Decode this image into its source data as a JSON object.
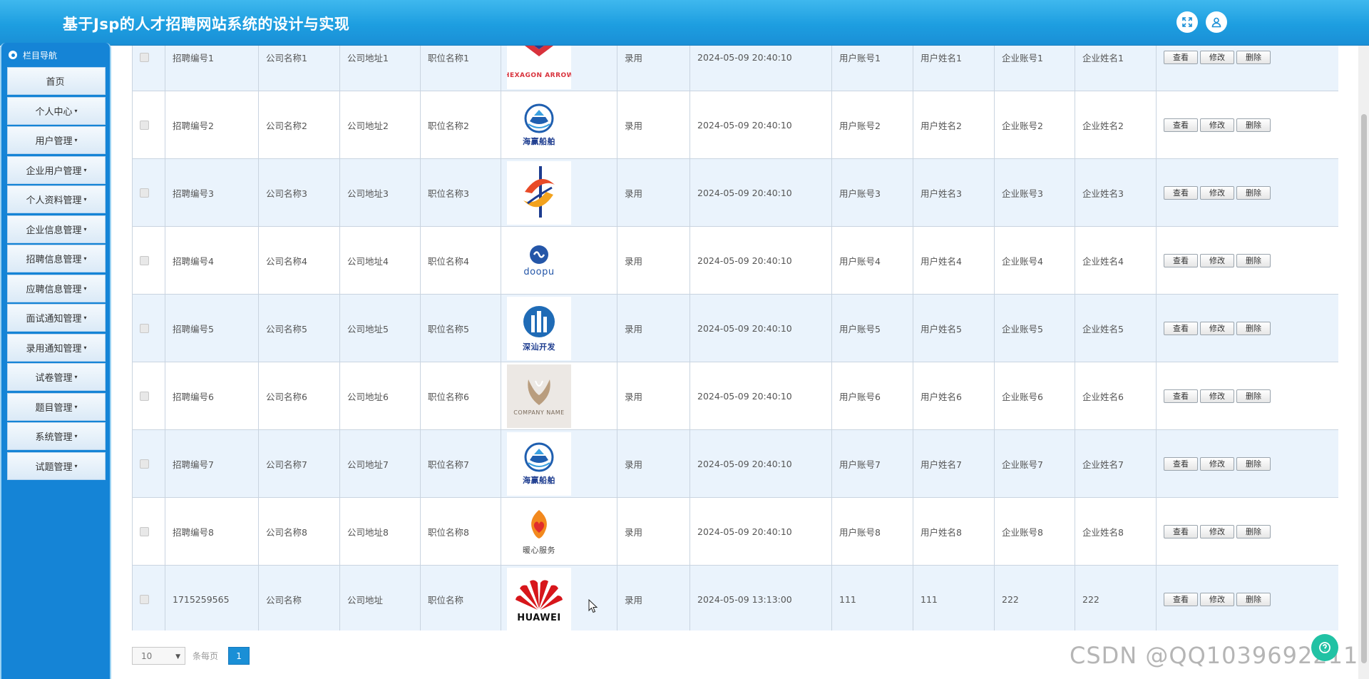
{
  "header": {
    "title": "基于Jsp的人才招聘网站系统的设计与实现"
  },
  "sidebar": {
    "heading": "栏目导航",
    "items": [
      {
        "label": "首页",
        "caret": ""
      },
      {
        "label": "个人中心",
        "caret": "▾"
      },
      {
        "label": "用户管理",
        "caret": "▾"
      },
      {
        "label": "企业用户管理",
        "caret": "▾"
      },
      {
        "label": "个人资料管理",
        "caret": "▾"
      },
      {
        "label": "企业信息管理",
        "caret": "▾"
      },
      {
        "label": "招聘信息管理",
        "caret": "▾"
      },
      {
        "label": "应聘信息管理",
        "caret": "▾"
      },
      {
        "label": "面试通知管理",
        "caret": "▾"
      },
      {
        "label": "录用通知管理",
        "caret": "▾"
      },
      {
        "label": "试卷管理",
        "caret": "▾"
      },
      {
        "label": "题目管理",
        "caret": "▾"
      },
      {
        "label": "系统管理",
        "caret": "▾"
      },
      {
        "label": "试题管理",
        "caret": "▾"
      }
    ]
  },
  "table": {
    "actions": {
      "view": "查看",
      "edit": "修改",
      "delete": "删除"
    },
    "rows": [
      {
        "id": "招聘编号1",
        "company": "公司名称1",
        "address": "公司地址1",
        "position": "职位名称1",
        "logo": "HEXAGON ARROW",
        "logo_icon": "hexagon-arrow-logo",
        "status": "录用",
        "time": "2024-05-09 20:40:10",
        "user_account": "用户账号1",
        "user_name": "用户姓名1",
        "ent_account": "企业账号1",
        "ent_name": "企业姓名1"
      },
      {
        "id": "招聘编号2",
        "company": "公司名称2",
        "address": "公司地址2",
        "position": "职位名称2",
        "logo": "海赢船舶",
        "logo_icon": "ship-logo",
        "status": "录用",
        "time": "2024-05-09 20:40:10",
        "user_account": "用户账号2",
        "user_name": "用户姓名2",
        "ent_account": "企业账号2",
        "ent_name": "企业姓名2"
      },
      {
        "id": "招聘编号3",
        "company": "公司名称3",
        "address": "公司地址3",
        "position": "职位名称3",
        "logo": "",
        "logo_icon": "swirl-logo",
        "status": "录用",
        "time": "2024-05-09 20:40:10",
        "user_account": "用户账号3",
        "user_name": "用户姓名3",
        "ent_account": "企业账号3",
        "ent_name": "企业姓名3"
      },
      {
        "id": "招聘编号4",
        "company": "公司名称4",
        "address": "公司地址4",
        "position": "职位名称4",
        "logo": "doopu",
        "logo_icon": "doopu-logo",
        "status": "录用",
        "time": "2024-05-09 20:40:10",
        "user_account": "用户账号4",
        "user_name": "用户姓名4",
        "ent_account": "企业账号4",
        "ent_name": "企业姓名4"
      },
      {
        "id": "招聘编号5",
        "company": "公司名称5",
        "address": "公司地址5",
        "position": "职位名称5",
        "logo": "深汕开发",
        "logo_icon": "city-logo",
        "status": "录用",
        "time": "2024-05-09 20:40:10",
        "user_account": "用户账号5",
        "user_name": "用户姓名5",
        "ent_account": "企业账号5",
        "ent_name": "企业姓名5"
      },
      {
        "id": "招聘编号6",
        "company": "公司名称6",
        "address": "公司地址6",
        "position": "职位名称6",
        "logo": "COMPANY NAME",
        "logo_icon": "company-name-logo",
        "status": "录用",
        "time": "2024-05-09 20:40:10",
        "user_account": "用户账号6",
        "user_name": "用户姓名6",
        "ent_account": "企业账号6",
        "ent_name": "企业姓名6"
      },
      {
        "id": "招聘编号7",
        "company": "公司名称7",
        "address": "公司地址7",
        "position": "职位名称7",
        "logo": "海赢船舶",
        "logo_icon": "ship-logo",
        "status": "录用",
        "time": "2024-05-09 20:40:10",
        "user_account": "用户账号7",
        "user_name": "用户姓名7",
        "ent_account": "企业账号7",
        "ent_name": "企业姓名7"
      },
      {
        "id": "招聘编号8",
        "company": "公司名称8",
        "address": "公司地址8",
        "position": "职位名称8",
        "logo": "暖心服务",
        "logo_icon": "heart-service-logo",
        "status": "录用",
        "time": "2024-05-09 20:40:10",
        "user_account": "用户账号8",
        "user_name": "用户姓名8",
        "ent_account": "企业账号8",
        "ent_name": "企业姓名8"
      },
      {
        "id": "1715259565",
        "company": "公司名称",
        "address": "公司地址",
        "position": "职位名称",
        "logo": "HUAWEI",
        "logo_icon": "huawei-logo",
        "status": "录用",
        "time": "2024-05-09 13:13:00",
        "user_account": "111",
        "user_name": "111",
        "ent_account": "222",
        "ent_name": "222"
      }
    ]
  },
  "pager": {
    "page_size": "10",
    "per_page_label": "条每页",
    "current_page": "1"
  },
  "watermark": "CSDN @QQ1039692211",
  "colors": {
    "primary": "#1a8fd6",
    "sidebar": "#1584d6",
    "row_stripe": "#eaf3fc"
  }
}
